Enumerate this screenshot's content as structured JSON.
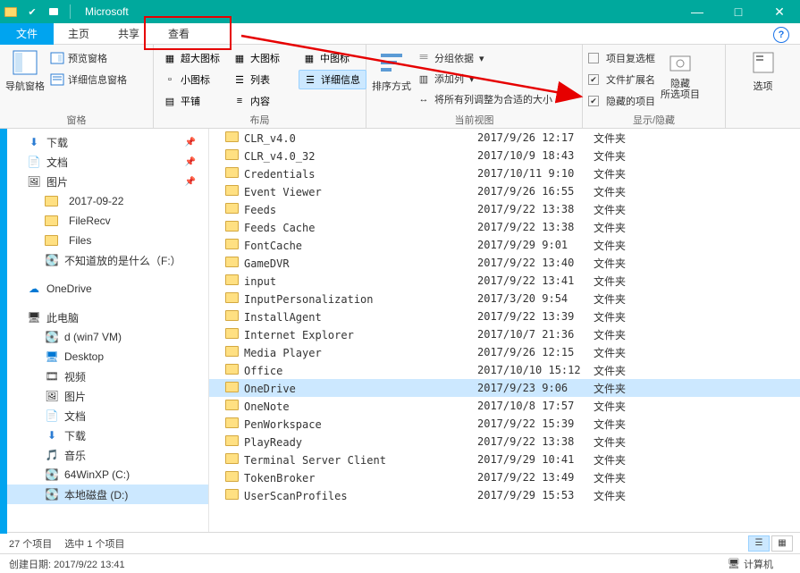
{
  "window": {
    "title": "Microsoft"
  },
  "tabs": {
    "file": "文件",
    "home": "主页",
    "share": "共享",
    "view": "查看"
  },
  "ribbon": {
    "panes": {
      "label": "窗格",
      "nav_pane": "导航窗格",
      "preview": "预览窗格",
      "details": "详细信息窗格"
    },
    "layout": {
      "label": "布局",
      "xlarge": "超大图标",
      "large": "大图标",
      "medium": "中图标",
      "small": "小图标",
      "list": "列表",
      "details": "详细信息",
      "tiles": "平铺",
      "content": "内容"
    },
    "current_view": {
      "label": "当前视图",
      "sort": "排序方式",
      "group_by": "分组依据",
      "add_cols": "添加列",
      "fit_cols": "将所有列调整为合适的大小"
    },
    "show_hide": {
      "label": "显示/隐藏",
      "checkboxes": "项目复选框",
      "ext": "文件扩展名",
      "hidden": "隐藏的项目",
      "hide_sel": "隐藏\n所选项目"
    },
    "options": {
      "label": "选项"
    }
  },
  "sidebar": {
    "downloads": "下载",
    "documents": "文档",
    "pictures": "图片",
    "date_folder": "2017-09-22",
    "filerecv": "FileRecv",
    "files": "Files",
    "unknown": "不知道放的是什么（F:）",
    "onedrive": "OneDrive",
    "this_pc": "此电脑",
    "win7": "d (win7 VM)",
    "desktop": "Desktop",
    "video": "视频",
    "pic2": "图片",
    "doc2": "文档",
    "dl2": "下载",
    "music": "音乐",
    "c_drive": "64WinXP (C:)",
    "d_drive": "本地磁盘 (D:)"
  },
  "files": [
    {
      "name": "CLR_v4.0",
      "date": "2017/9/26 12:17",
      "type": "文件夹",
      "sel": false
    },
    {
      "name": "CLR_v4.0_32",
      "date": "2017/10/9 18:43",
      "type": "文件夹",
      "sel": false
    },
    {
      "name": "Credentials",
      "date": "2017/10/11 9:10",
      "type": "文件夹",
      "sel": false
    },
    {
      "name": "Event Viewer",
      "date": "2017/9/26 16:55",
      "type": "文件夹",
      "sel": false
    },
    {
      "name": "Feeds",
      "date": "2017/9/22 13:38",
      "type": "文件夹",
      "sel": false
    },
    {
      "name": "Feeds Cache",
      "date": "2017/9/22 13:38",
      "type": "文件夹",
      "sel": false
    },
    {
      "name": "FontCache",
      "date": "2017/9/29 9:01",
      "type": "文件夹",
      "sel": false
    },
    {
      "name": "GameDVR",
      "date": "2017/9/22 13:40",
      "type": "文件夹",
      "sel": false
    },
    {
      "name": "input",
      "date": "2017/9/22 13:41",
      "type": "文件夹",
      "sel": false
    },
    {
      "name": "InputPersonalization",
      "date": "2017/3/20 9:54",
      "type": "文件夹",
      "sel": false
    },
    {
      "name": "InstallAgent",
      "date": "2017/9/22 13:39",
      "type": "文件夹",
      "sel": false
    },
    {
      "name": "Internet Explorer",
      "date": "2017/10/7 21:36",
      "type": "文件夹",
      "sel": false
    },
    {
      "name": "Media Player",
      "date": "2017/9/26 12:15",
      "type": "文件夹",
      "sel": false
    },
    {
      "name": "Office",
      "date": "2017/10/10 15:12",
      "type": "文件夹",
      "sel": false
    },
    {
      "name": "OneDrive",
      "date": "2017/9/23 9:06",
      "type": "文件夹",
      "sel": true
    },
    {
      "name": "OneNote",
      "date": "2017/10/8 17:57",
      "type": "文件夹",
      "sel": false
    },
    {
      "name": "PenWorkspace",
      "date": "2017/9/22 15:39",
      "type": "文件夹",
      "sel": false
    },
    {
      "name": "PlayReady",
      "date": "2017/9/22 13:38",
      "type": "文件夹",
      "sel": false
    },
    {
      "name": "Terminal Server Client",
      "date": "2017/9/29 10:41",
      "type": "文件夹",
      "sel": false
    },
    {
      "name": "TokenBroker",
      "date": "2017/9/22 13:49",
      "type": "文件夹",
      "sel": false
    },
    {
      "name": "UserScanProfiles",
      "date": "2017/9/29 15:53",
      "type": "文件夹",
      "sel": false
    }
  ],
  "status": {
    "count": "27 个项目",
    "selected": "选中 1 个项目"
  },
  "infobar": {
    "created": "创建日期: 2017/9/22 13:41",
    "computer": "计算机"
  }
}
